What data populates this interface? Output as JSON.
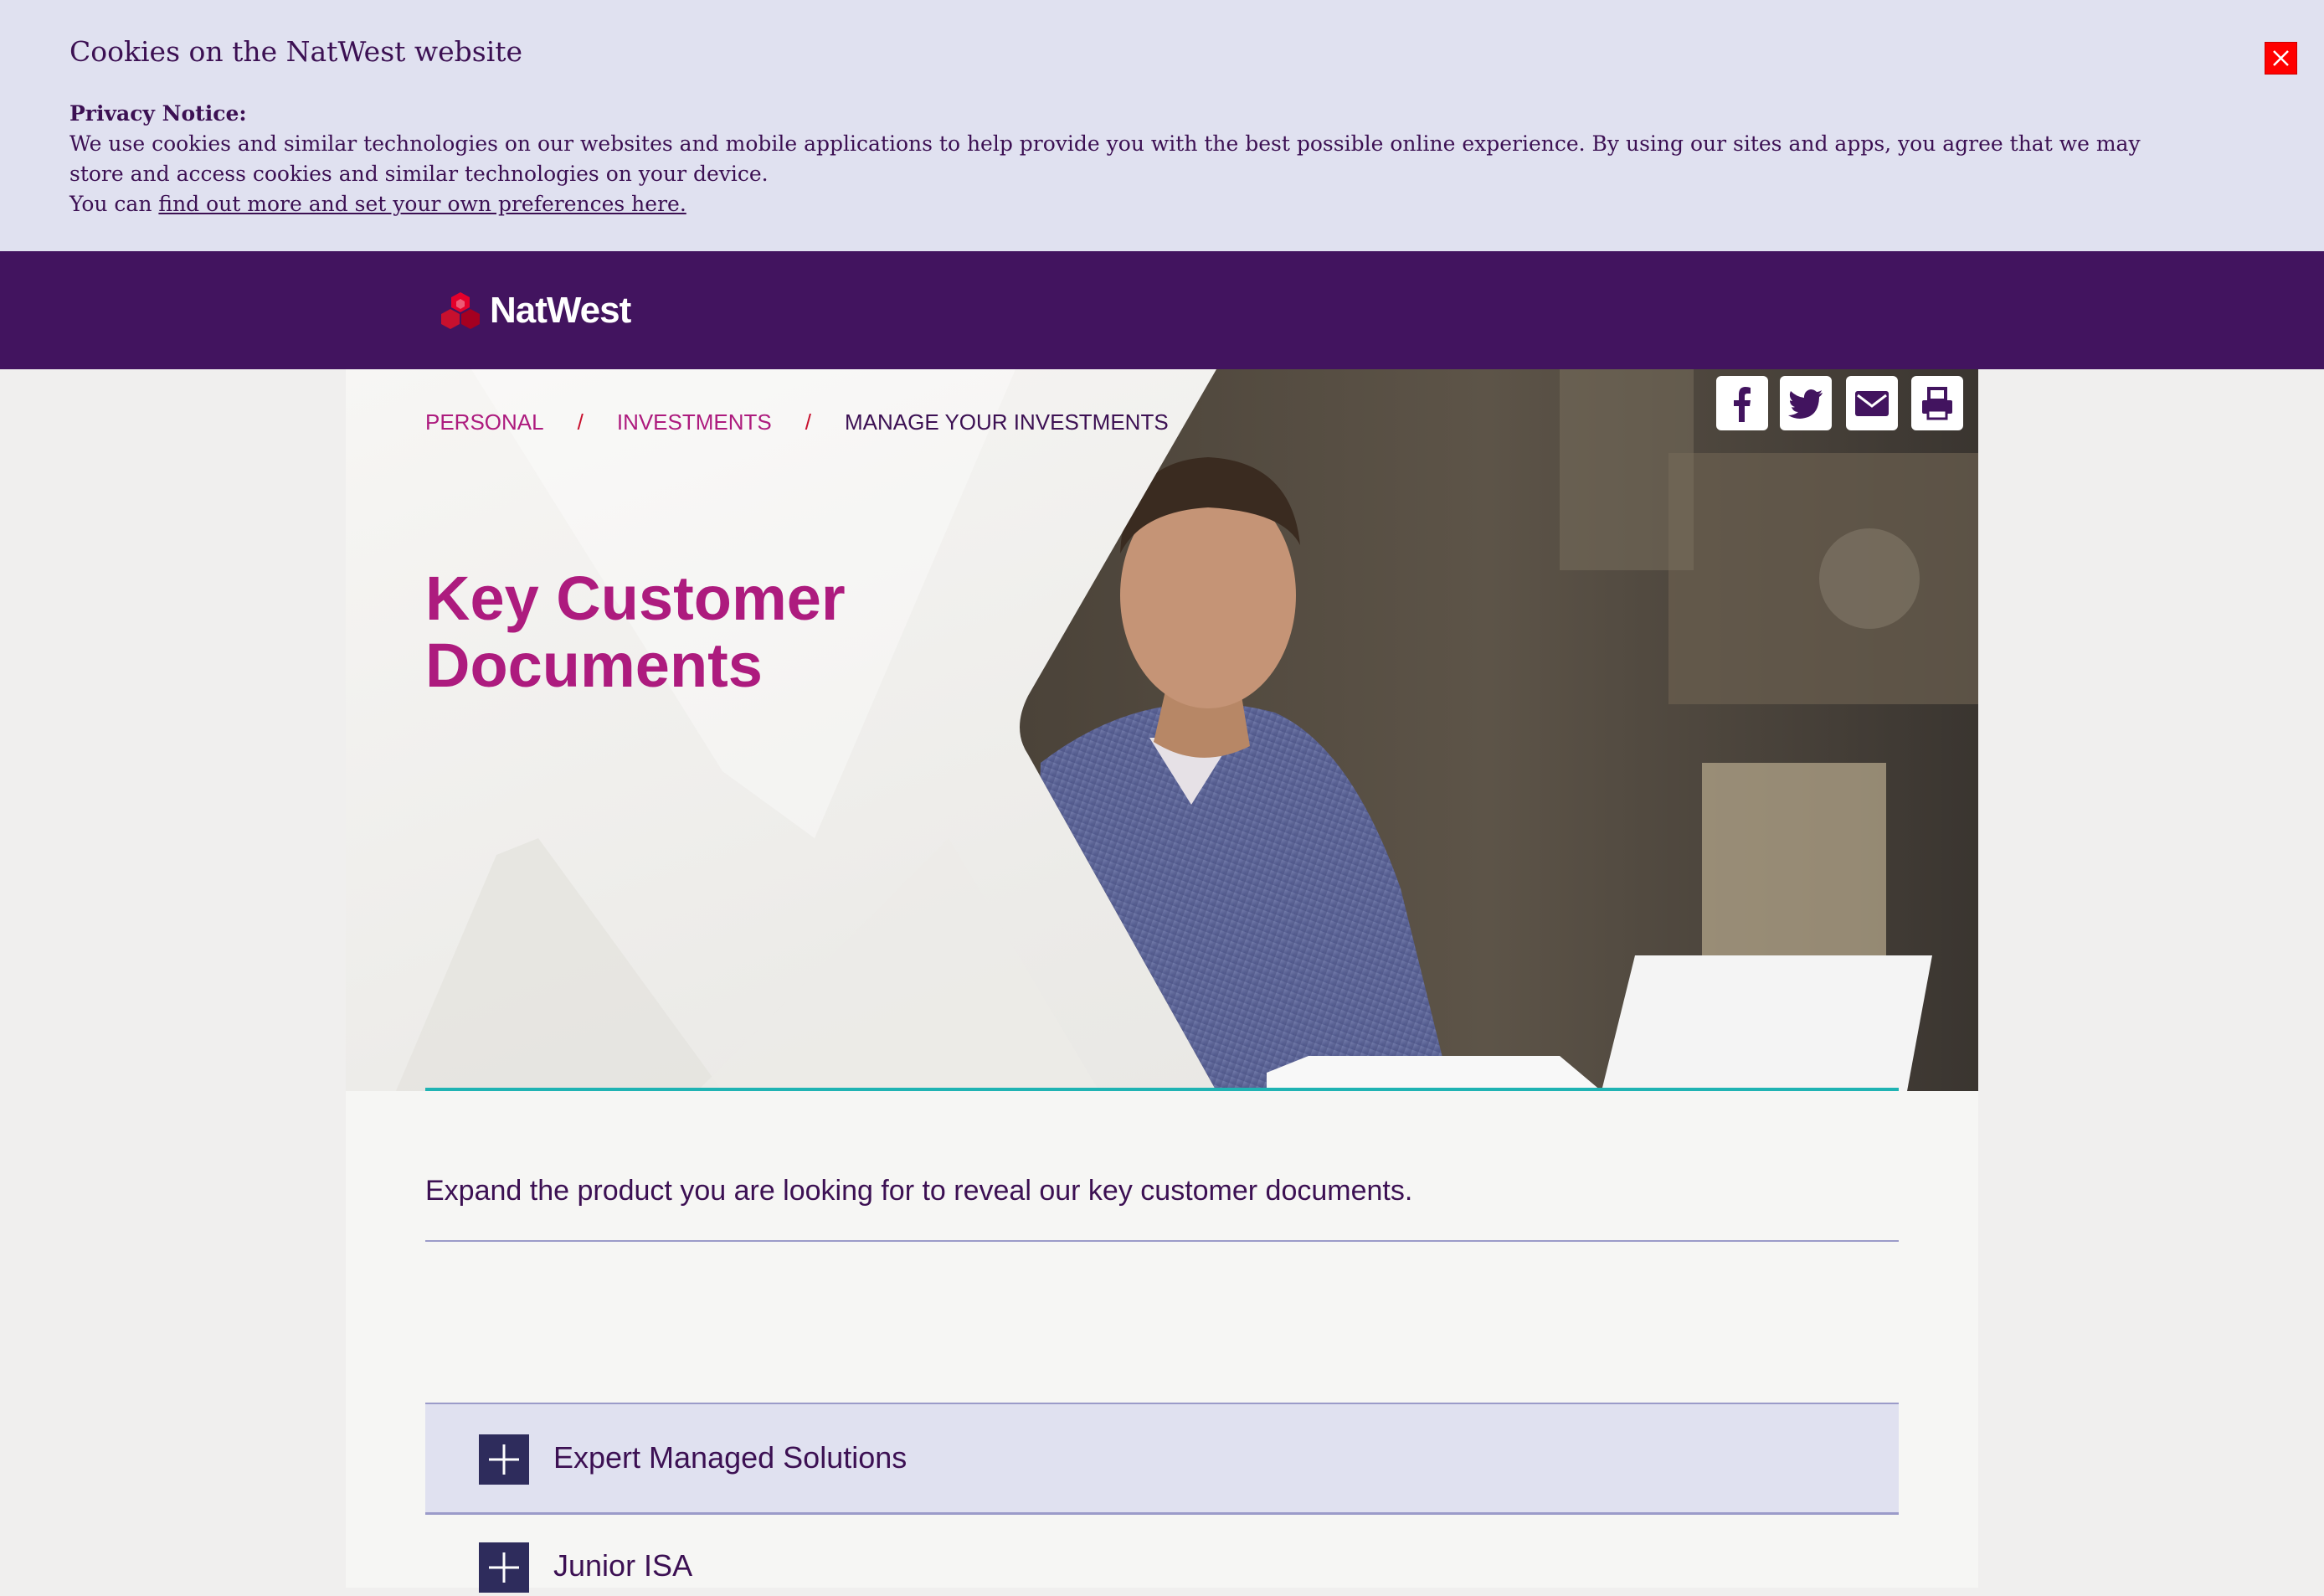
{
  "cookie_banner": {
    "title": "Cookies on the NatWest website",
    "notice_heading": "Privacy Notice:",
    "notice_text": "We use cookies and similar technologies on our websites and mobile applications to help provide you with the best possible online experience. By using our sites and apps, you agree that we may store and access cookies and similar technologies on your device.",
    "preferences_prefix": "You can ",
    "preferences_link": "find out more and set your own preferences here.",
    "close_icon": "close-icon",
    "close_color": "#ff0000"
  },
  "header": {
    "logo_text": "NatWest",
    "logo_icon": "natwest-cubes-icon",
    "background": "#42145f"
  },
  "breadcrumb": {
    "items": [
      "PERSONAL",
      "INVESTMENTS",
      "MANAGE YOUR INVESTMENTS"
    ],
    "separator": "/"
  },
  "share": {
    "icons": [
      "facebook-icon",
      "twitter-icon",
      "email-icon",
      "print-icon"
    ]
  },
  "hero": {
    "title": "Key Customer Documents",
    "title_line1": "Key Customer",
    "title_line2": "Documents",
    "accent": "#ad1b7e"
  },
  "intro": {
    "text": "Expand the product you are looking for to reveal our key customer documents."
  },
  "accordion": {
    "items": [
      {
        "label": "Expert Managed Solutions",
        "icon": "plus-icon"
      },
      {
        "label": "Junior ISA",
        "icon": "plus-icon"
      }
    ]
  }
}
